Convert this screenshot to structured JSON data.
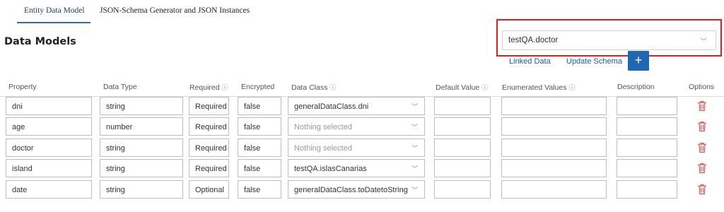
{
  "tabs": [
    {
      "label": "Entity Data Model"
    },
    {
      "label": "JSON-Schema Generator and JSON Instances"
    }
  ],
  "page_title": "Data Models",
  "model_select": {
    "value": "testQA.doctor"
  },
  "links": {
    "linked_data": "Linked Data",
    "update_schema": "Update Schema"
  },
  "add_button": {
    "label": "+"
  },
  "columns": {
    "property": "Property",
    "data_type": "Data Type",
    "required": "Required",
    "encrypted": "Encrypted",
    "data_class": "Data Class",
    "default_value": "Default Value",
    "enumerated_values": "Enumerated Values",
    "description": "Description",
    "options": "Options"
  },
  "info_glyph": "ⓘ",
  "rows": [
    {
      "property": "dni",
      "data_type": "string",
      "required": "Required",
      "encrypted": "false",
      "data_class": "generalDataClass.dni"
    },
    {
      "property": "age",
      "data_type": "number",
      "required": "Required",
      "encrypted": "false",
      "data_class": "Nothing selected"
    },
    {
      "property": "doctor",
      "data_type": "string",
      "required": "Required",
      "encrypted": "false",
      "data_class": "Nothing selected"
    },
    {
      "property": "island",
      "data_type": "string",
      "required": "Required",
      "encrypted": "false",
      "data_class": "testQA.islasCanarias"
    },
    {
      "property": "date",
      "data_type": "string",
      "required": "Optional",
      "encrypted": "false",
      "data_class": "generalDataClass.toDatetoString"
    }
  ],
  "icons": {
    "chevron": "chevron-down-icon",
    "trash": "trash-icon",
    "info": "info-icon"
  },
  "colors": {
    "accent": "#1f67b1",
    "highlight": "#e0201f",
    "trash": "#d9534f",
    "link": "#1a5fa8"
  }
}
